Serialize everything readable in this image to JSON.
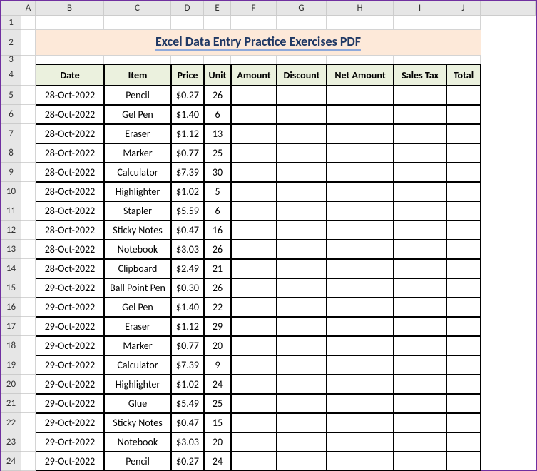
{
  "columns_letters": [
    "A",
    "B",
    "C",
    "D",
    "E",
    "F",
    "G",
    "H",
    "I",
    "J"
  ],
  "row_numbers": [
    1,
    2,
    3,
    4,
    5,
    6,
    7,
    8,
    9,
    10,
    11,
    12,
    13,
    14,
    15,
    16,
    17,
    18,
    19,
    20,
    21,
    22,
    23,
    24
  ],
  "title": "Excel Data Entry Practice Exercises PDF",
  "headers": [
    "Date",
    "Item",
    "Price",
    "Unit",
    "Amount",
    "Discount",
    "Net Amount",
    "Sales Tax",
    "Total"
  ],
  "chart_data": {
    "type": "table",
    "title": "Excel Data Entry Practice Exercises PDF",
    "columns": [
      "Date",
      "Item",
      "Price",
      "Unit",
      "Amount",
      "Discount",
      "Net Amount",
      "Sales Tax",
      "Total"
    ],
    "rows": [
      [
        "28-Oct-2022",
        "Pencil",
        "$0.27",
        "26",
        "",
        "",
        "",
        "",
        ""
      ],
      [
        "28-Oct-2022",
        "Gel Pen",
        "$1.40",
        "6",
        "",
        "",
        "",
        "",
        ""
      ],
      [
        "28-Oct-2022",
        "Eraser",
        "$1.12",
        "13",
        "",
        "",
        "",
        "",
        ""
      ],
      [
        "28-Oct-2022",
        "Marker",
        "$0.77",
        "25",
        "",
        "",
        "",
        "",
        ""
      ],
      [
        "28-Oct-2022",
        "Calculator",
        "$7.39",
        "30",
        "",
        "",
        "",
        "",
        ""
      ],
      [
        "28-Oct-2022",
        "Highlighter",
        "$1.02",
        "5",
        "",
        "",
        "",
        "",
        ""
      ],
      [
        "28-Oct-2022",
        "Stapler",
        "$5.59",
        "6",
        "",
        "",
        "",
        "",
        ""
      ],
      [
        "28-Oct-2022",
        "Sticky Notes",
        "$0.47",
        "16",
        "",
        "",
        "",
        "",
        ""
      ],
      [
        "28-Oct-2022",
        "Notebook",
        "$3.03",
        "26",
        "",
        "",
        "",
        "",
        ""
      ],
      [
        "28-Oct-2022",
        "Clipboard",
        "$2.49",
        "21",
        "",
        "",
        "",
        "",
        ""
      ],
      [
        "29-Oct-2022",
        "Ball Point Pen",
        "$0.30",
        "26",
        "",
        "",
        "",
        "",
        ""
      ],
      [
        "29-Oct-2022",
        "Gel Pen",
        "$1.40",
        "22",
        "",
        "",
        "",
        "",
        ""
      ],
      [
        "29-Oct-2022",
        "Eraser",
        "$1.12",
        "29",
        "",
        "",
        "",
        "",
        ""
      ],
      [
        "29-Oct-2022",
        "Marker",
        "$0.77",
        "20",
        "",
        "",
        "",
        "",
        ""
      ],
      [
        "29-Oct-2022",
        "Calculator",
        "$7.39",
        "9",
        "",
        "",
        "",
        "",
        ""
      ],
      [
        "29-Oct-2022",
        "Highlighter",
        "$1.02",
        "24",
        "",
        "",
        "",
        "",
        ""
      ],
      [
        "29-Oct-2022",
        "Glue",
        "$5.49",
        "25",
        "",
        "",
        "",
        "",
        ""
      ],
      [
        "29-Oct-2022",
        "Sticky Notes",
        "$0.47",
        "15",
        "",
        "",
        "",
        "",
        ""
      ],
      [
        "29-Oct-2022",
        "Notebook",
        "$3.03",
        "20",
        "",
        "",
        "",
        "",
        ""
      ],
      [
        "29-Oct-2022",
        "Pencil",
        "$0.27",
        "24",
        "",
        "",
        "",
        "",
        ""
      ]
    ]
  }
}
